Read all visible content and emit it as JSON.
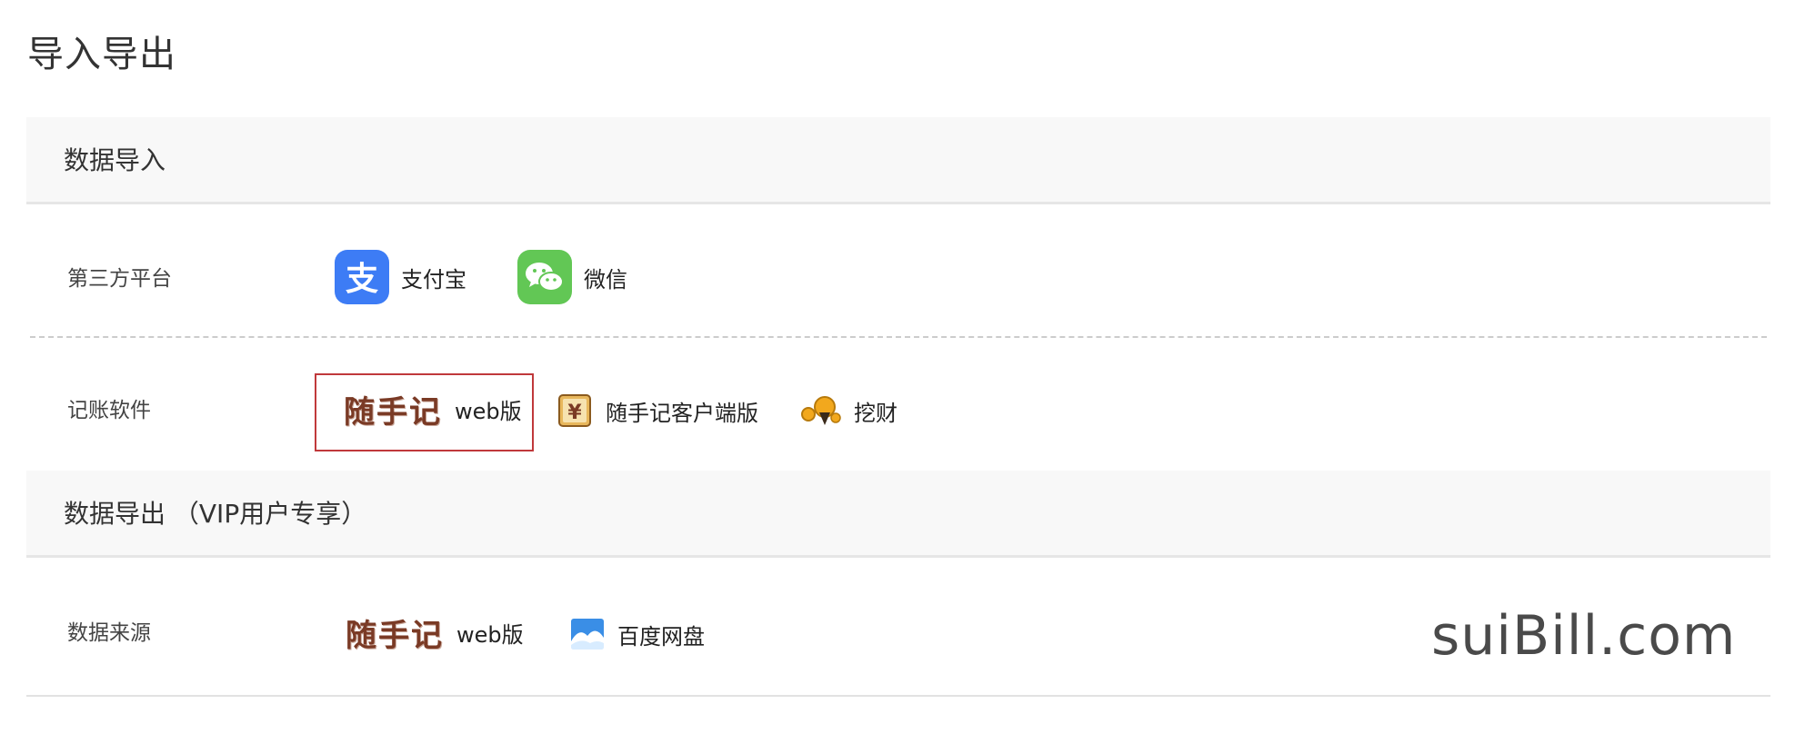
{
  "page": {
    "title": "导入导出"
  },
  "import_section": {
    "title": "数据导入",
    "rows": {
      "third_party": {
        "label": "第三方平台",
        "options": [
          {
            "label": "支付宝",
            "icon": "alipay-icon",
            "color": "#3d7cf5"
          },
          {
            "label": "微信",
            "icon": "wechat-icon",
            "color": "#62c755"
          }
        ]
      },
      "software": {
        "label": "记账软件",
        "options": [
          {
            "logo_text": "随手记",
            "label": "web版",
            "icon": "suishouji-logo",
            "selected": true
          },
          {
            "label": "随手记客户端版",
            "icon": "suishouji-client-icon"
          },
          {
            "label": "挖财",
            "icon": "wacai-icon"
          }
        ]
      }
    }
  },
  "export_section": {
    "title": "数据导出 （VIP用户专享）",
    "rows": {
      "source": {
        "label": "数据来源",
        "options": [
          {
            "logo_text": "随手记",
            "label": "web版",
            "icon": "suishouji-logo"
          },
          {
            "label": "百度网盘",
            "icon": "baidu-netdisk-icon"
          }
        ]
      }
    }
  },
  "watermark": {
    "text": "suiBill.com"
  },
  "colors": {
    "selected_border": "#c0393b",
    "header_bg": "#f8f8f8",
    "logo_text": "#7a3a25"
  }
}
